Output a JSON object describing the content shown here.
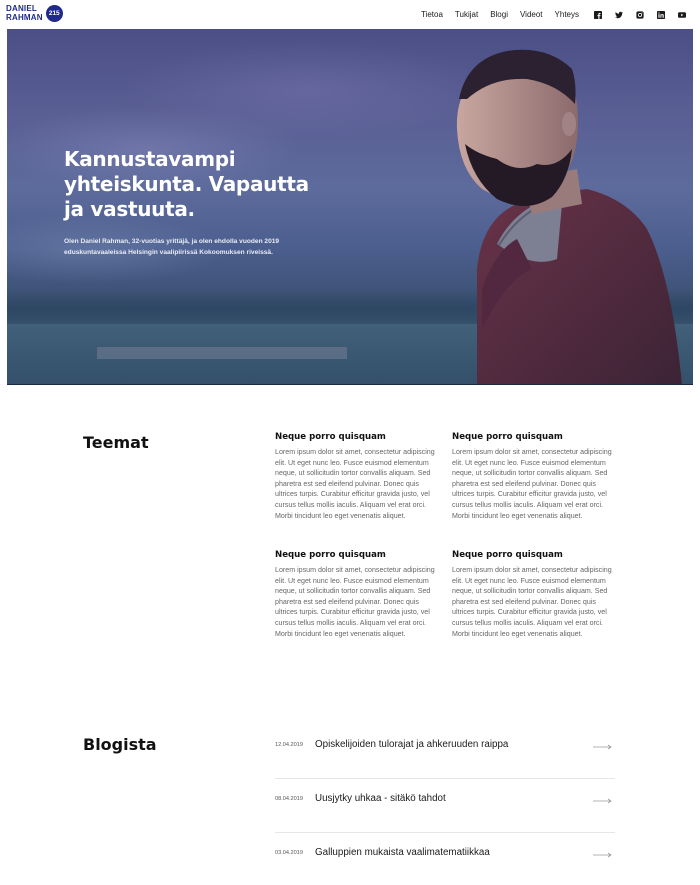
{
  "header": {
    "logo_line1": "DANIEL",
    "logo_line2": "RAHMAN",
    "logo_number": "215",
    "nav": [
      "Tietoa",
      "Tukijat",
      "Blogi",
      "Videot",
      "Yhteys"
    ],
    "social_icons": [
      "facebook-icon",
      "twitter-icon",
      "instagram-icon",
      "linkedin-icon",
      "youtube-icon"
    ]
  },
  "hero": {
    "title": "Kannustavampi yhteiskunta. Vapautta ja vastuuta.",
    "subtitle": "Olen Daniel Rahman, 32-vuotias yrittäjä, ja olen ehdolla vuoden 2019 eduskuntavaaleissa Helsingin vaalipiirissä Kokoomuksen riveissä."
  },
  "themes": {
    "title": "Teemat",
    "items": [
      {
        "title": "Neque porro quisquam",
        "body": "Lorem ipsum dolor sit amet, consectetur adipiscing elit. Ut eget nunc leo. Fusce euismod elementum neque, ut sollicitudin tortor convallis aliquam. Sed pharetra est sed eleifend pulvinar. Donec quis ultrices turpis. Curabitur efficitur gravida justo, vel cursus tellus mollis iaculis. Aliquam vel erat orci. Morbi tincidunt leo eget venenatis aliquet."
      },
      {
        "title": "Neque porro quisquam",
        "body": "Lorem ipsum dolor sit amet, consectetur adipiscing elit. Ut eget nunc leo. Fusce euismod elementum neque, ut sollicitudin tortor convallis aliquam. Sed pharetra est sed eleifend pulvinar. Donec quis ultrices turpis. Curabitur efficitur gravida justo, vel cursus tellus mollis iaculis. Aliquam vel erat orci. Morbi tincidunt leo eget venenatis aliquet."
      },
      {
        "title": "Neque porro quisquam",
        "body": "Lorem ipsum dolor sit amet, consectetur adipiscing elit. Ut eget nunc leo. Fusce euismod elementum neque, ut sollicitudin tortor convallis aliquam. Sed pharetra est sed eleifend pulvinar. Donec quis ultrices turpis. Curabitur efficitur gravida justo, vel cursus tellus mollis iaculis. Aliquam vel erat orci. Morbi tincidunt leo eget venenatis aliquet."
      },
      {
        "title": "Neque porro quisquam",
        "body": "Lorem ipsum dolor sit amet, consectetur adipiscing elit. Ut eget nunc leo. Fusce euismod elementum neque, ut sollicitudin tortor convallis aliquam. Sed pharetra est sed eleifend pulvinar. Donec quis ultrices turpis. Curabitur efficitur gravida justo, vel cursus tellus mollis iaculis. Aliquam vel erat orci. Morbi tincidunt leo eget venenatis aliquet."
      }
    ]
  },
  "blog": {
    "title": "Blogista",
    "posts": [
      {
        "date": "12.04.2019",
        "title": "Opiskelijoiden tulorajat ja ahkeruuden raippa"
      },
      {
        "date": "08.04.2019",
        "title": "Uusjytky uhkaa - sitäkö tahdot"
      },
      {
        "date": "03.04.2019",
        "title": "Galluppien mukaista vaalimatematiikkaa"
      }
    ]
  },
  "colors": {
    "brand": "#1f2a8c",
    "text": "#1b1b1b",
    "muted": "#666666"
  }
}
